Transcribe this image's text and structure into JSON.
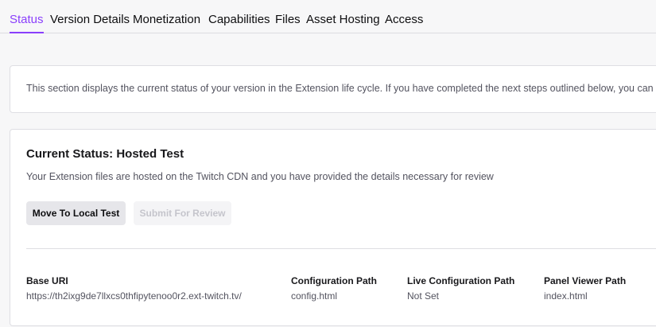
{
  "tabs": [
    {
      "label": "Status",
      "active": true
    },
    {
      "label": "Version Details"
    },
    {
      "label": "Monetization"
    },
    {
      "label": "Capabilities"
    },
    {
      "label": "Files"
    },
    {
      "label": "Asset Hosting"
    },
    {
      "label": "Access"
    }
  ],
  "intro": {
    "text": "This section displays the current status of your version in the Extension life cycle. If you have completed the next steps outlined below, you can pr"
  },
  "status": {
    "title": "Current Status: Hosted Test",
    "description": "Your Extension files are hosted on the Twitch CDN and you have provided the details necessary for review",
    "primary_button": "Move To Local Test",
    "disabled_button": "Submit For Review"
  },
  "fields": [
    {
      "label": "Base URI",
      "value": "https://th2ixg9de7llxcs0thfipytenoo0r2.ext-twitch.tv/"
    },
    {
      "label": "Configuration Path",
      "value": "config.html"
    },
    {
      "label": "Live Configuration Path",
      "value": "Not Set"
    },
    {
      "label": "Panel Viewer Path",
      "value": "index.html"
    }
  ],
  "colors": {
    "accent": "#8a3ffc",
    "background": "#f7f7f8",
    "card": "#ffffff"
  }
}
